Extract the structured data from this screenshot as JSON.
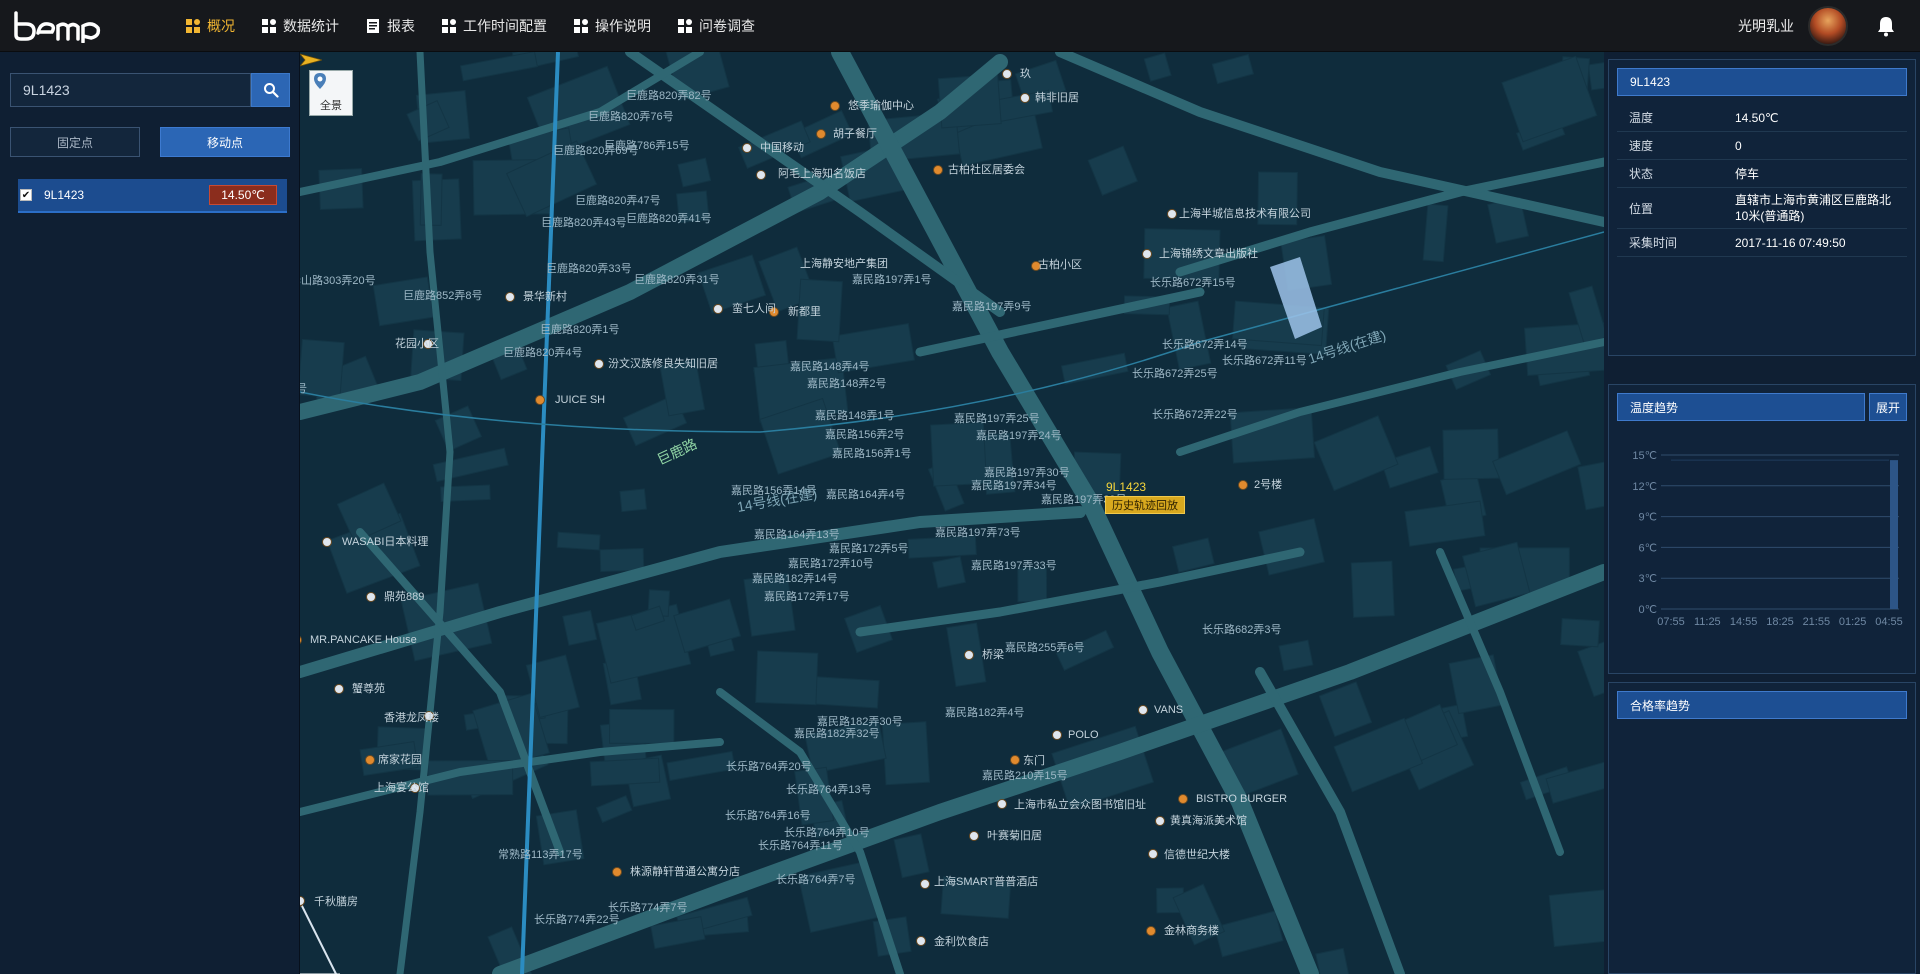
{
  "nav": {
    "items": [
      {
        "label": "概况",
        "icon": "dashboard-icon",
        "active": true
      },
      {
        "label": "数据统计",
        "icon": "grid-icon"
      },
      {
        "label": "报表",
        "icon": "report-icon"
      },
      {
        "label": "工作时间配置",
        "icon": "grid-icon"
      },
      {
        "label": "操作说明",
        "icon": "grid-icon"
      },
      {
        "label": "问卷调查",
        "icon": "grid-icon"
      }
    ],
    "company": "光明乳业"
  },
  "left": {
    "search_value": "9L1423",
    "tab_fixed": "固定点",
    "tab_moving": "移动点",
    "vehicle": {
      "name": "9L1423",
      "temp": "14.50℃"
    }
  },
  "map": {
    "pano_label": "全景",
    "marker_label": "9L1423",
    "history_btn": "历史轨迹回放",
    "road_labels": [
      {
        "text": "巨鹿路820弄82号"
      },
      {
        "text": "巨鹿路820弄76号"
      },
      {
        "text": "巨鹿路820弄69号"
      },
      {
        "text": "巨鹿路786弄15号"
      },
      {
        "text": "巨鹿路820弄47号"
      },
      {
        "text": "巨鹿路820弄43号"
      },
      {
        "text": "巨鹿路820弄41号"
      },
      {
        "text": "巨鹿路820弄33号"
      },
      {
        "text": "巨鹿路820弄31号"
      },
      {
        "text": "华山路303弄20号"
      },
      {
        "text": "巨鹿路852弄8号"
      },
      {
        "text": "巨鹿路820弄1号"
      },
      {
        "text": "巨鹿路820弄4号"
      },
      {
        "text": "嘉民路197弄1号"
      },
      {
        "text": "嘉民路197弄9号"
      },
      {
        "text": "嘉民路148弄4号"
      },
      {
        "text": "嘉民路148弄2号"
      },
      {
        "text": "嘉民路148弄1号"
      },
      {
        "text": "嘉民路156弄2号"
      },
      {
        "text": "嘉民路156弄1号"
      },
      {
        "text": "嘉民路197弄25号"
      },
      {
        "text": "嘉民路197弄24号"
      },
      {
        "text": "嘉民路156弄14号"
      },
      {
        "text": "嘉民路164弄4号"
      },
      {
        "text": "嘉民路197弄30号"
      },
      {
        "text": "嘉民路197弄34号"
      },
      {
        "text": "嘉民路197弄39号"
      },
      {
        "text": "嘉民路164弄13号"
      },
      {
        "text": "嘉民路172弄5号"
      },
      {
        "text": "嘉民路197弄73号"
      },
      {
        "text": "嘉民路172弄10号"
      },
      {
        "text": "嘉民路197弄33号"
      },
      {
        "text": "嘉民路182弄14号"
      },
      {
        "text": "嘉民路172弄17号"
      },
      {
        "text": "嘉民路255弄6号"
      },
      {
        "text": "嘉民路182弄4号"
      },
      {
        "text": "嘉民路182弄30号"
      },
      {
        "text": "嘉民路182弄32号"
      },
      {
        "text": "长乐路764弄20号"
      },
      {
        "text": "长乐路764弄13号"
      },
      {
        "text": "嘉民路210弄15号"
      },
      {
        "text": "长乐路764弄16号"
      },
      {
        "text": "长乐路764弄10号"
      },
      {
        "text": "长乐路764弄11号"
      },
      {
        "text": "常熟路113弄17号"
      },
      {
        "text": "长乐路764弄7号"
      },
      {
        "text": "长乐路774弄22号"
      },
      {
        "text": "长乐路774弄7号"
      },
      {
        "text": "长乐路672弄15号"
      },
      {
        "text": "长乐路672弄14号"
      },
      {
        "text": "长乐路672弄11号"
      },
      {
        "text": "长乐路672弄25号"
      },
      {
        "text": "长乐路672弄22号"
      },
      {
        "text": "长乐路682弄3号"
      },
      {
        "text": "7号"
      }
    ],
    "pois": [
      {
        "text": "悠季瑜伽中心"
      },
      {
        "text": "韩非旧居"
      },
      {
        "text": "玖"
      },
      {
        "text": "胡子餐厅"
      },
      {
        "text": "中国移动"
      },
      {
        "text": "阿毛上海知名饭店"
      },
      {
        "text": "古柏社区居委会"
      },
      {
        "text": "上海半城信息技术有限公司"
      },
      {
        "text": "上海锦绣文章出版社"
      },
      {
        "text": "上海静安地产集团"
      },
      {
        "text": "古柏小区"
      },
      {
        "text": "景华新村"
      },
      {
        "text": "蛮七人间"
      },
      {
        "text": "新都里"
      },
      {
        "text": "花园小区"
      },
      {
        "text": "汾文汉族修良失知旧居"
      },
      {
        "text": "JUICE SH"
      },
      {
        "text": "WASABI日本料理"
      },
      {
        "text": "鼎苑889"
      },
      {
        "text": "MR.PANCAKE House"
      },
      {
        "text": "蟹尊苑"
      },
      {
        "text": "香港龙凤楼"
      },
      {
        "text": "席家花园"
      },
      {
        "text": "上海宴公馆"
      },
      {
        "text": "桥梁"
      },
      {
        "text": "东门"
      },
      {
        "text": "POLO"
      },
      {
        "text": "VANS"
      },
      {
        "text": "2号楼"
      },
      {
        "text": "上海市私立会众图书馆旧址"
      },
      {
        "text": "叶赛菊旧居"
      },
      {
        "text": "BISTRO BURGER"
      },
      {
        "text": "黄真海派美术馆"
      },
      {
        "text": "信德世纪大楼"
      },
      {
        "text": "株源静轩普通公寓分店"
      },
      {
        "text": "上海SMART普普酒店"
      },
      {
        "text": "金利饮食店"
      },
      {
        "text": "金林商务楼"
      },
      {
        "text": "千秋膳房"
      }
    ],
    "street_names": [
      {
        "text": "巨鹿路"
      },
      {
        "text": "14号线(在建)"
      },
      {
        "text": "14号线(在建)"
      }
    ]
  },
  "right": {
    "info_title": "9L1423",
    "rows": [
      {
        "k": "温度",
        "v": "14.50℃"
      },
      {
        "k": "速度",
        "v": "0"
      },
      {
        "k": "状态",
        "v": "停车"
      },
      {
        "k": "位置",
        "v": "直辖市上海市黄浦区巨鹿路北10米(普通路)"
      },
      {
        "k": "采集时间",
        "v": "2017-11-16 07:49:50"
      }
    ],
    "trend_title": "温度趋势",
    "expand_label": "展开",
    "pass_title": "合格率趋势"
  },
  "chart_data": {
    "type": "line",
    "title": "温度趋势",
    "x": [
      "07:55",
      "11:25",
      "14:55",
      "18:25",
      "21:55",
      "01:25",
      "04:55"
    ],
    "y_ticks": [
      "15℃",
      "12℃",
      "9℃",
      "6℃",
      "3℃",
      "0℃"
    ],
    "ylim": [
      0,
      15
    ],
    "series": [
      {
        "values": [
          14.5,
          14.5,
          14.5,
          14.5,
          14.5,
          14.5,
          14.5
        ]
      }
    ],
    "grid": true
  },
  "colors": {
    "accent": "#f2b632",
    "primary": "#2b66b5",
    "alert": "#8b2d1d",
    "map_bg": "#0e2a3a",
    "road": "#2f6773"
  }
}
